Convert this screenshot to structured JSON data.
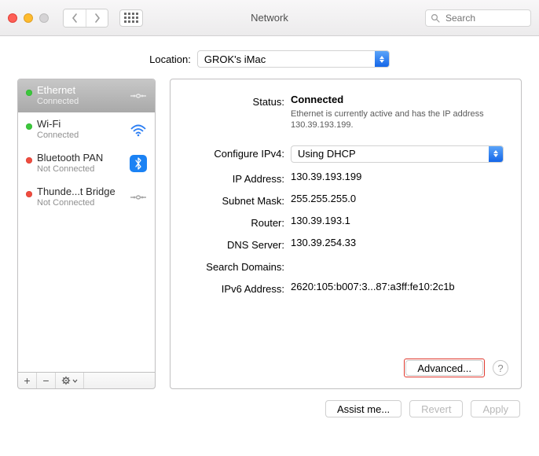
{
  "window": {
    "title": "Network"
  },
  "toolbar": {
    "search_placeholder": "Search"
  },
  "location": {
    "label": "Location:",
    "value": "GROK's iMac"
  },
  "interfaces": [
    {
      "name": "Ethernet",
      "status": "Connected",
      "dot": "green",
      "icon": "ethernet"
    },
    {
      "name": "Wi-Fi",
      "status": "Connected",
      "dot": "green",
      "icon": "wifi"
    },
    {
      "name": "Bluetooth PAN",
      "status": "Not Connected",
      "dot": "red",
      "icon": "bluetooth"
    },
    {
      "name": "Thunde...t Bridge",
      "status": "Not Connected",
      "dot": "red",
      "icon": "thunderbolt"
    }
  ],
  "detail": {
    "status_label": "Status:",
    "status_value": "Connected",
    "status_desc": "Ethernet is currently active and has the IP address 130.39.193.199.",
    "configure_label": "Configure IPv4:",
    "configure_value": "Using DHCP",
    "ip_label": "IP Address:",
    "ip_value": "130.39.193.199",
    "mask_label": "Subnet Mask:",
    "mask_value": "255.255.255.0",
    "router_label": "Router:",
    "router_value": "130.39.193.1",
    "dns_label": "DNS Server:",
    "dns_value": "130.39.254.33",
    "search_label": "Search Domains:",
    "search_value": "",
    "ipv6_label": "IPv6 Address:",
    "ipv6_value": "2620:105:b007:3...87:a3ff:fe10:2c1b",
    "advanced_label": "Advanced...",
    "help_label": "?"
  },
  "footer": {
    "assist": "Assist me...",
    "revert": "Revert",
    "apply": "Apply"
  }
}
